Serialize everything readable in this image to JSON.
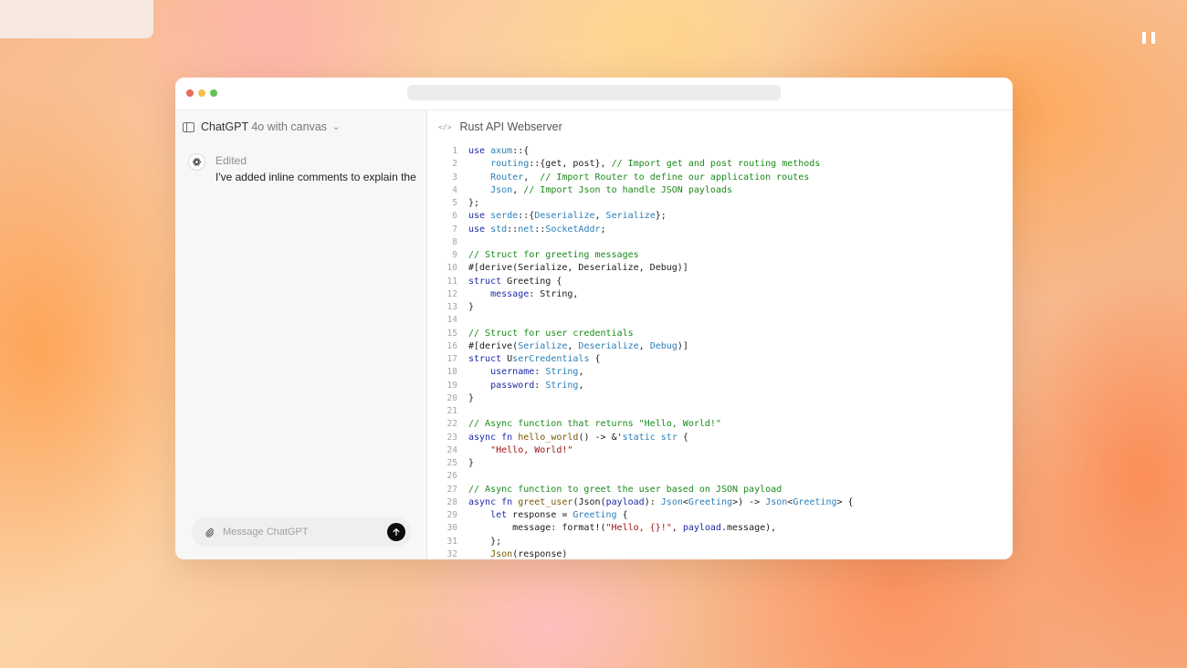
{
  "window": {
    "url_bar_text": ""
  },
  "sidebar": {
    "model_name": "ChatGPT",
    "model_suffix": " 4o with canvas",
    "status": "Edited",
    "message": "I've added inline comments to explain the",
    "composer_placeholder": "Message ChatGPT"
  },
  "canvas": {
    "title": "Rust API Webserver"
  },
  "code_lines": [
    [
      {
        "t": "use",
        "c": "kw"
      },
      {
        "t": " "
      },
      {
        "t": "axum",
        "c": "ty"
      },
      {
        "t": "::{"
      }
    ],
    [
      {
        "t": "    "
      },
      {
        "t": "routing",
        "c": "ty"
      },
      {
        "t": "::{get, post}, "
      },
      {
        "t": "// Import get and post routing methods",
        "c": "cm"
      }
    ],
    [
      {
        "t": "    "
      },
      {
        "t": "Router",
        "c": "ty"
      },
      {
        "t": ",  "
      },
      {
        "t": "// Import Router to define our application routes",
        "c": "cm"
      }
    ],
    [
      {
        "t": "    "
      },
      {
        "t": "Json",
        "c": "ty"
      },
      {
        "t": ", "
      },
      {
        "t": "// Import Json to handle JSON payloads",
        "c": "cm"
      }
    ],
    [
      {
        "t": "};"
      }
    ],
    [
      {
        "t": "use",
        "c": "kw"
      },
      {
        "t": " "
      },
      {
        "t": "serde",
        "c": "ty"
      },
      {
        "t": "::{"
      },
      {
        "t": "Deserialize",
        "c": "ty"
      },
      {
        "t": ", "
      },
      {
        "t": "Serialize",
        "c": "ty"
      },
      {
        "t": "};"
      }
    ],
    [
      {
        "t": "use",
        "c": "kw"
      },
      {
        "t": " "
      },
      {
        "t": "std",
        "c": "ty"
      },
      {
        "t": "::"
      },
      {
        "t": "net",
        "c": "ty"
      },
      {
        "t": "::"
      },
      {
        "t": "SocketAddr",
        "c": "ty"
      },
      {
        "t": ";"
      }
    ],
    [],
    [
      {
        "t": "// Struct for greeting messages",
        "c": "cm"
      }
    ],
    [
      {
        "t": "#[derive(Serialize, Deserialize, Debug)]"
      }
    ],
    [
      {
        "t": "struct",
        "c": "kw"
      },
      {
        "t": " Greeting {"
      }
    ],
    [
      {
        "t": "    "
      },
      {
        "t": "message",
        "c": "kw"
      },
      {
        "t": ": String,"
      }
    ],
    [
      {
        "t": "}"
      }
    ],
    [],
    [
      {
        "t": "// Struct for user credentials",
        "c": "cm"
      }
    ],
    [
      {
        "t": "#[derive("
      },
      {
        "t": "Serialize",
        "c": "ty"
      },
      {
        "t": ", "
      },
      {
        "t": "Deserialize",
        "c": "ty"
      },
      {
        "t": ", "
      },
      {
        "t": "Debug",
        "c": "ty"
      },
      {
        "t": ")]"
      }
    ],
    [
      {
        "t": "struct",
        "c": "kw"
      },
      {
        "t": " U"
      },
      {
        "t": "serCredentials",
        "c": "ty"
      },
      {
        "t": " {"
      }
    ],
    [
      {
        "t": "    "
      },
      {
        "t": "username",
        "c": "kw"
      },
      {
        "t": ": "
      },
      {
        "t": "String",
        "c": "ty"
      },
      {
        "t": ","
      }
    ],
    [
      {
        "t": "    "
      },
      {
        "t": "password",
        "c": "kw"
      },
      {
        "t": ": "
      },
      {
        "t": "String",
        "c": "ty"
      },
      {
        "t": ","
      }
    ],
    [
      {
        "t": "}"
      }
    ],
    [],
    [
      {
        "t": "// Async function that returns \"Hello, World!\"",
        "c": "cm"
      }
    ],
    [
      {
        "t": "async",
        "c": "kw"
      },
      {
        "t": " "
      },
      {
        "t": "fn",
        "c": "kw"
      },
      {
        "t": " "
      },
      {
        "t": "hello_world",
        "c": "fn"
      },
      {
        "t": "() -> &'"
      },
      {
        "t": "static",
        "c": "ty"
      },
      {
        "t": " "
      },
      {
        "t": "str",
        "c": "ty"
      },
      {
        "t": " {"
      }
    ],
    [
      {
        "t": "    "
      },
      {
        "t": "\"Hello, World!\"",
        "c": "st"
      }
    ],
    [
      {
        "t": "}"
      }
    ],
    [],
    [
      {
        "t": "// Async function to greet the user based on JSON payload",
        "c": "cm"
      }
    ],
    [
      {
        "t": "async",
        "c": "kw"
      },
      {
        "t": " "
      },
      {
        "t": "fn",
        "c": "kw"
      },
      {
        "t": " "
      },
      {
        "t": "greet_user",
        "c": "fn"
      },
      {
        "t": "(Json("
      },
      {
        "t": "payload",
        "c": "kw"
      },
      {
        "t": "): "
      },
      {
        "t": "Json",
        "c": "ty"
      },
      {
        "t": "<"
      },
      {
        "t": "Greeting",
        "c": "ty"
      },
      {
        "t": ">) -> "
      },
      {
        "t": "Json",
        "c": "ty"
      },
      {
        "t": "<"
      },
      {
        "t": "Greeting",
        "c": "ty"
      },
      {
        "t": "> {"
      }
    ],
    [
      {
        "t": "    "
      },
      {
        "t": "let",
        "c": "kw"
      },
      {
        "t": " response = "
      },
      {
        "t": "Greeting",
        "c": "ty"
      },
      {
        "t": " {"
      }
    ],
    [
      {
        "t": "        message: format!("
      },
      {
        "t": "\"Hello, {}!\"",
        "c": "st"
      },
      {
        "t": ", "
      },
      {
        "t": "payload",
        "c": "kw"
      },
      {
        "t": ".message),"
      }
    ],
    [
      {
        "t": "    };"
      }
    ],
    [
      {
        "t": "    "
      },
      {
        "t": "Json",
        "c": "fn"
      },
      {
        "t": "(response)"
      }
    ]
  ]
}
